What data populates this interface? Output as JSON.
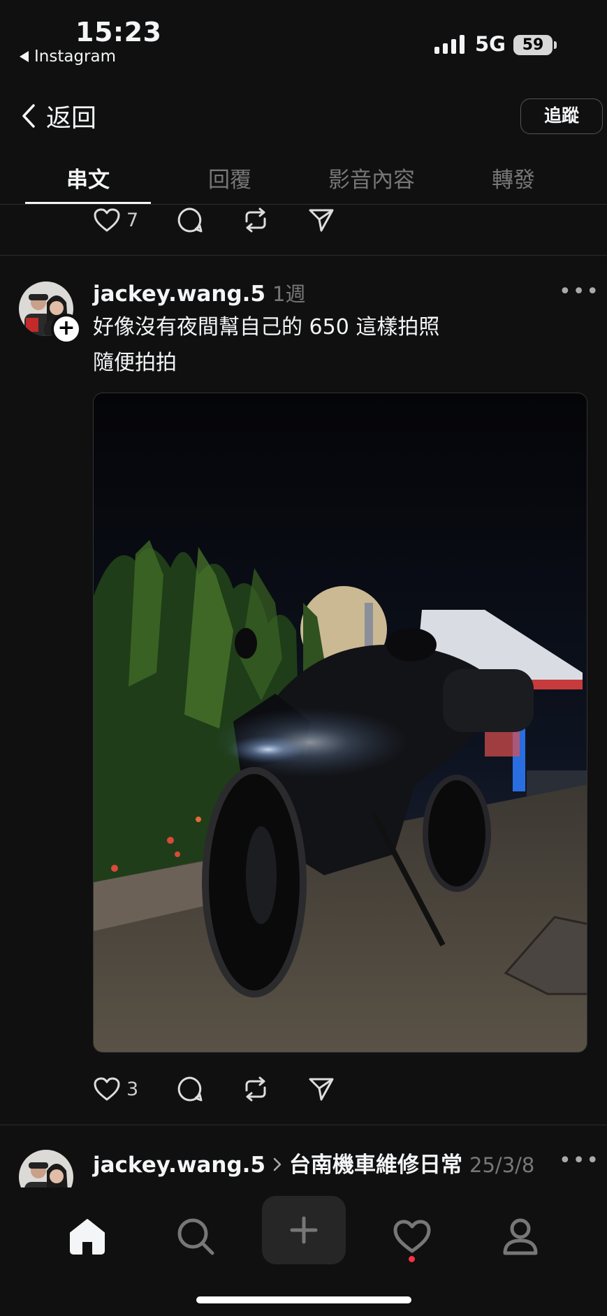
{
  "status_bar": {
    "time": "15:23",
    "back_app": "Instagram",
    "network": "5G",
    "battery": "59"
  },
  "nav": {
    "back_label": "返回",
    "follow_label": "追蹤"
  },
  "tabs": [
    {
      "label": "串文",
      "active": true
    },
    {
      "label": "回覆",
      "active": false
    },
    {
      "label": "影音內容",
      "active": false
    },
    {
      "label": "轉發",
      "active": false
    }
  ],
  "prev_post": {
    "like_count": "7"
  },
  "post": {
    "username": "jackey.wang.5",
    "time_ago": "1週",
    "text_line1": "好像沒有夜間幫自己的 650 這樣拍照",
    "text_line2": "隨便拍拍",
    "like_count": "3"
  },
  "next_post": {
    "username": "jackey.wang.5",
    "community": "台南機車維修日常",
    "date": "25/3/8"
  },
  "colors": {
    "background": "#101010",
    "text": "#f3f5f7",
    "muted": "#777777",
    "notification_dot": "#ff3040"
  }
}
